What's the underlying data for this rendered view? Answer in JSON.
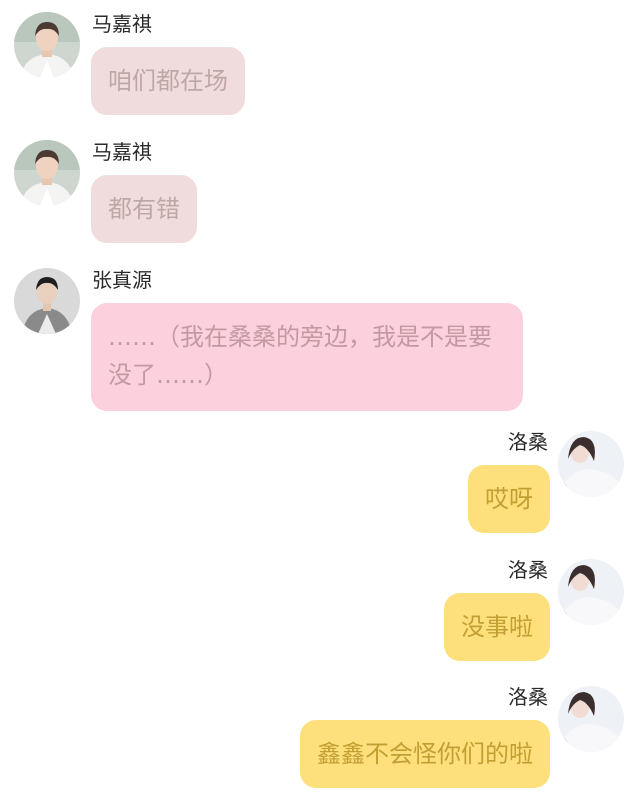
{
  "messages": [
    {
      "sender": "马嘉祺",
      "text": "咱们都在场",
      "side": "left",
      "avatar": "male-avatar-white-shirt",
      "bubble_color": "#f0dcdc"
    },
    {
      "sender": "马嘉祺",
      "text": "都有错",
      "side": "left",
      "avatar": "male-avatar-white-shirt",
      "bubble_color": "#f0dcdc"
    },
    {
      "sender": "张真源",
      "text": "……（我在桑桑的旁边，我是不是要没了……）",
      "side": "left",
      "avatar": "male-avatar-grey-suit",
      "bubble_color": "#fcd0dc"
    },
    {
      "sender": "洛桑",
      "text": "哎呀",
      "side": "right",
      "avatar": "female-avatar",
      "bubble_color": "#fde07c"
    },
    {
      "sender": "洛桑",
      "text": "没事啦",
      "side": "right",
      "avatar": "female-avatar",
      "bubble_color": "#fde07c"
    },
    {
      "sender": "洛桑",
      "text": "鑫鑫不会怪你们的啦",
      "side": "right",
      "avatar": "female-avatar",
      "bubble_color": "#fde07c"
    }
  ]
}
